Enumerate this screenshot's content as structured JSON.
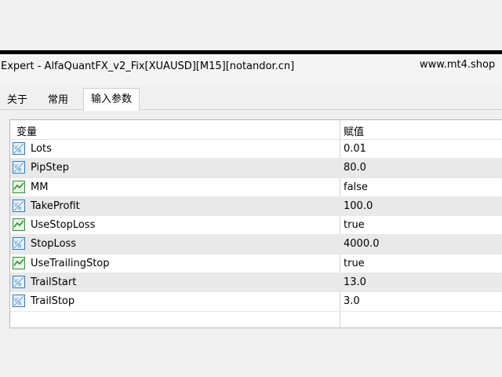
{
  "window": {
    "title": "Expert - AlfaQuantFX_v2_Fix[XUAUSD][M15][notandor.cn]",
    "watermark": "www.mt4.shop"
  },
  "tabs": [
    {
      "label": "关于",
      "active": false
    },
    {
      "label": "常用",
      "active": false
    },
    {
      "label": "输入参数",
      "active": true
    }
  ],
  "table": {
    "headers": {
      "variable": "变量",
      "value": "赋值"
    },
    "rows": [
      {
        "icon": "numeric-value-icon",
        "name": "Lots",
        "value": "0.01"
      },
      {
        "icon": "numeric-value-icon",
        "name": "PipStep",
        "value": "80.0"
      },
      {
        "icon": "boolean-value-icon",
        "name": "MM",
        "value": "false"
      },
      {
        "icon": "numeric-value-icon",
        "name": "TakeProfit",
        "value": "100.0"
      },
      {
        "icon": "boolean-value-icon",
        "name": "UseStopLoss",
        "value": "true"
      },
      {
        "icon": "numeric-value-icon",
        "name": "StopLoss",
        "value": "4000.0"
      },
      {
        "icon": "boolean-value-icon",
        "name": "UseTrailingStop",
        "value": "true"
      },
      {
        "icon": "numeric-value-icon",
        "name": "TrailStart",
        "value": "13.0"
      },
      {
        "icon": "numeric-value-icon",
        "name": "TrailStop",
        "value": "3.0"
      }
    ]
  },
  "colors": {
    "numeric_icon": "#2e7bbf",
    "boolean_icon": "#2f8f2f",
    "alt_row": "#e9e9e9"
  }
}
